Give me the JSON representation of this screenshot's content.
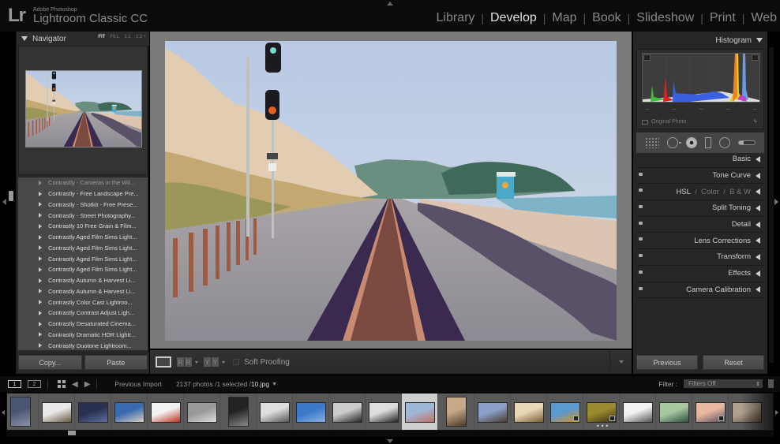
{
  "app": {
    "logo": "Lr",
    "vendor": "Adobe Photoshop",
    "title": "Lightroom Classic CC"
  },
  "modules": [
    {
      "label": "Library",
      "active": false
    },
    {
      "label": "Develop",
      "active": true
    },
    {
      "label": "Map",
      "active": false
    },
    {
      "label": "Book",
      "active": false
    },
    {
      "label": "Slideshow",
      "active": false
    },
    {
      "label": "Print",
      "active": false
    },
    {
      "label": "Web",
      "active": false
    }
  ],
  "navigator": {
    "title": "Navigator",
    "zoom_options": [
      "FIT",
      "FILL",
      "1:1",
      "1:2 ÷"
    ],
    "active_zoom": "FIT"
  },
  "presets": [
    "Contrastly - Cameras in the Wil...",
    "Contrastly - Free Landscape Pre...",
    "Contrastly - Shotkit - Free Prese...",
    "Contrastly - Street Photography...",
    "Contrastly 10 Free Grain & Film...",
    "Contrastly Aged Film Sims Light...",
    "Contrastly Aged Film Sims Light...",
    "Contrastly Aged Film Sims Light...",
    "Contrastly Aged Film Sims Light...",
    "Contrastly Autumn & Harvest Li...",
    "Contrastly Autumn & Harvest Li...",
    "Contrastly Color Cast Lightroo...",
    "Contrastly Contrast Adjust Ligh...",
    "Contrastly Desaturated Cinema...",
    "Contrastly Dramatic HDR Lightr...",
    "Contrastly Duotone Lightroom..."
  ],
  "left_buttons": {
    "copy": "Copy...",
    "paste": "Paste"
  },
  "toolbar": {
    "before_after_1": "RR",
    "before_after_2": "YY",
    "soft_proofing_label": "Soft Proofing",
    "soft_proofing_checked": false
  },
  "histogram": {
    "title": "Histogram",
    "original_photo_label": "Original Photo"
  },
  "right_panels": [
    {
      "label": "Basic",
      "has_switch": false
    },
    {
      "label": "Tone Curve",
      "has_switch": true
    },
    {
      "label": "HSL",
      "extra": [
        "Color",
        "B & W"
      ],
      "has_switch": true
    },
    {
      "label": "Split Toning",
      "has_switch": true
    },
    {
      "label": "Detail",
      "has_switch": true
    },
    {
      "label": "Lens Corrections",
      "has_switch": true
    },
    {
      "label": "Transform",
      "has_switch": true
    },
    {
      "label": "Effects",
      "has_switch": true
    },
    {
      "label": "Camera Calibration",
      "has_switch": true
    }
  ],
  "right_buttons": {
    "previous": "Previous",
    "reset": "Reset"
  },
  "filmstrip_bar": {
    "screen1": "1",
    "screen2": "2",
    "source": "Previous Import",
    "count_text": "2137 photos /1 selected /",
    "filename": "10.jpg",
    "filter_label": "Filter :",
    "filter_value": "Filters Off"
  },
  "filmstrip": {
    "selected_index": 11,
    "thumbs": [
      {
        "desc": "building-facade",
        "colors": [
          "#4a5570",
          "#8a93a8"
        ]
      },
      {
        "desc": "white-architecture",
        "colors": [
          "#e8e8e8",
          "#6a5a40"
        ]
      },
      {
        "desc": "blue-dome-ceiling",
        "colors": [
          "#2a3050",
          "#5a70a0"
        ]
      },
      {
        "desc": "stadium-roof",
        "colors": [
          "#3a6ab0",
          "#d8d0c0"
        ]
      },
      {
        "desc": "red-arch",
        "colors": [
          "#f2f2f2",
          "#c03020"
        ]
      },
      {
        "desc": "arched-corridor",
        "colors": [
          "#999",
          "#ddd"
        ]
      },
      {
        "desc": "triangle-building",
        "colors": [
          "#222",
          "#888"
        ]
      },
      {
        "desc": "spiral-staircase",
        "colors": [
          "#ddd",
          "#555"
        ]
      },
      {
        "desc": "space-needle",
        "colors": [
          "#3a78c8",
          "#8ab0e0"
        ]
      },
      {
        "desc": "tunnel-bw",
        "colors": [
          "#ccc",
          "#222"
        ]
      },
      {
        "desc": "bw-street",
        "colors": [
          "#ddd",
          "#222"
        ]
      },
      {
        "desc": "railroad-beach",
        "colors": [
          "#a0b8d8",
          "#c07060"
        ]
      },
      {
        "desc": "bird-portrait",
        "colors": [
          "#c8a888",
          "#4a3a2a"
        ]
      },
      {
        "desc": "sunset-beach",
        "colors": [
          "#8aa0c8",
          "#4a3a30"
        ]
      },
      {
        "desc": "vintage-car",
        "colors": [
          "#e8d8b8",
          "#7a5a30"
        ]
      },
      {
        "desc": "coastal-cliffs",
        "colors": [
          "#5a98d0",
          "#d89020"
        ]
      },
      {
        "desc": "golden-landscape",
        "colors": [
          "#9a8a30",
          "#3a3010"
        ]
      },
      {
        "desc": "bw-pier",
        "colors": [
          "#f2f2f2",
          "#555"
        ]
      },
      {
        "desc": "green-palm",
        "colors": [
          "#a8c8a0",
          "#2a5040"
        ]
      },
      {
        "desc": "pink-sunset",
        "colors": [
          "#e8b8a0",
          "#5a4a60"
        ]
      },
      {
        "desc": "sepia-scene",
        "colors": [
          "#b0a090",
          "#605040"
        ]
      }
    ]
  }
}
